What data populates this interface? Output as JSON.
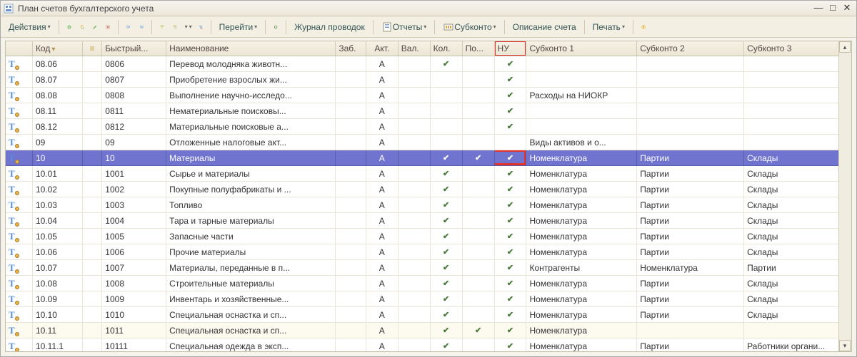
{
  "title": "План счетов бухгалтерского учета",
  "toolbar": {
    "actions": "Действия",
    "go": "Перейти",
    "journal": "Журнал проводок",
    "reports": "Отчеты",
    "subconto": "Субконто",
    "desc": "Описание счета",
    "print": "Печать"
  },
  "columns": {
    "c0": "",
    "code": "Код",
    "sort": "",
    "fast": "Быстрый...",
    "name": "Наименование",
    "zab": "Заб.",
    "akt": "Акт.",
    "val": "Вал.",
    "kol": "Кол.",
    "po": "По...",
    "nu": "НУ",
    "sub1": "Субконто 1",
    "sub2": "Субконто 2",
    "sub3": "Субконто 3"
  },
  "rows": [
    {
      "code": "08.06",
      "fast": "0806",
      "name": "Перевод молодняка животн...",
      "akt": "А",
      "val": "",
      "kol": "✔",
      "po": "",
      "nu": "✔",
      "s1": "",
      "s2": "",
      "s3": ""
    },
    {
      "code": "08.07",
      "fast": "0807",
      "name": "Приобретение взрослых жи...",
      "akt": "А",
      "val": "",
      "kol": "",
      "po": "",
      "nu": "✔",
      "s1": "",
      "s2": "",
      "s3": ""
    },
    {
      "code": "08.08",
      "fast": "0808",
      "name": "Выполнение научно-исследо...",
      "akt": "А",
      "val": "",
      "kol": "",
      "po": "",
      "nu": "✔",
      "s1": "Расходы на НИОКР",
      "s2": "",
      "s3": ""
    },
    {
      "code": "08.11",
      "fast": "0811",
      "name": "Нематериальные поисковы...",
      "akt": "А",
      "val": "",
      "kol": "",
      "po": "",
      "nu": "✔",
      "s1": "",
      "s2": "",
      "s3": ""
    },
    {
      "code": "08.12",
      "fast": "0812",
      "name": "Материальные поисковые а...",
      "akt": "А",
      "val": "",
      "kol": "",
      "po": "",
      "nu": "✔",
      "s1": "",
      "s2": "",
      "s3": ""
    },
    {
      "code": "09",
      "fast": "09",
      "name": "Отложенные налоговые акт...",
      "akt": "А",
      "val": "",
      "kol": "",
      "po": "",
      "nu": "",
      "s1": "Виды активов и о...",
      "s2": "",
      "s3": ""
    },
    {
      "code": "10",
      "fast": "10",
      "name": "Материалы",
      "akt": "А",
      "val": "",
      "kol": "✔",
      "po": "✔",
      "nu": "✔",
      "s1": "Номенклатура",
      "s2": "Партии",
      "s3": "Склады",
      "selected": true,
      "redcell": true
    },
    {
      "code": "10.01",
      "fast": "1001",
      "name": "Сырье и материалы",
      "akt": "А",
      "val": "",
      "kol": "✔",
      "po": "",
      "nu": "✔",
      "s1": "Номенклатура",
      "s2": "Партии",
      "s3": "Склады"
    },
    {
      "code": "10.02",
      "fast": "1002",
      "name": "Покупные полуфабрикаты и ...",
      "akt": "А",
      "val": "",
      "kol": "✔",
      "po": "",
      "nu": "✔",
      "s1": "Номенклатура",
      "s2": "Партии",
      "s3": "Склады"
    },
    {
      "code": "10.03",
      "fast": "1003",
      "name": "Топливо",
      "akt": "А",
      "val": "",
      "kol": "✔",
      "po": "",
      "nu": "✔",
      "s1": "Номенклатура",
      "s2": "Партии",
      "s3": "Склады"
    },
    {
      "code": "10.04",
      "fast": "1004",
      "name": "Тара и тарные материалы",
      "akt": "А",
      "val": "",
      "kol": "✔",
      "po": "",
      "nu": "✔",
      "s1": "Номенклатура",
      "s2": "Партии",
      "s3": "Склады"
    },
    {
      "code": "10.05",
      "fast": "1005",
      "name": "Запасные части",
      "akt": "А",
      "val": "",
      "kol": "✔",
      "po": "",
      "nu": "✔",
      "s1": "Номенклатура",
      "s2": "Партии",
      "s3": "Склады"
    },
    {
      "code": "10.06",
      "fast": "1006",
      "name": "Прочие материалы",
      "akt": "А",
      "val": "",
      "kol": "✔",
      "po": "",
      "nu": "✔",
      "s1": "Номенклатура",
      "s2": "Партии",
      "s3": "Склады"
    },
    {
      "code": "10.07",
      "fast": "1007",
      "name": "Материалы, переданные в п...",
      "akt": "А",
      "val": "",
      "kol": "✔",
      "po": "",
      "nu": "✔",
      "s1": "Контрагенты",
      "s2": "Номенклатура",
      "s3": "Партии"
    },
    {
      "code": "10.08",
      "fast": "1008",
      "name": "Строительные материалы",
      "akt": "А",
      "val": "",
      "kol": "✔",
      "po": "",
      "nu": "✔",
      "s1": "Номенклатура",
      "s2": "Партии",
      "s3": "Склады"
    },
    {
      "code": "10.09",
      "fast": "1009",
      "name": "Инвентарь и хозяйственные...",
      "akt": "А",
      "val": "",
      "kol": "✔",
      "po": "",
      "nu": "✔",
      "s1": "Номенклатура",
      "s2": "Партии",
      "s3": "Склады"
    },
    {
      "code": "10.10",
      "fast": "1010",
      "name": "Специальная оснастка и сп...",
      "akt": "А",
      "val": "",
      "kol": "✔",
      "po": "",
      "nu": "✔",
      "s1": "Номенклатура",
      "s2": "Партии",
      "s3": "Склады"
    },
    {
      "code": "10.11",
      "fast": "1011",
      "name": "Специальная оснастка и сп...",
      "akt": "А",
      "val": "",
      "kol": "✔",
      "po": "✔",
      "nu": "✔",
      "s1": "Номенклатура",
      "s2": "",
      "s3": "",
      "alt": true
    },
    {
      "code": "10.11.1",
      "fast": "10111",
      "name": "Специальная одежда в эксп...",
      "akt": "А",
      "val": "",
      "kol": "✔",
      "po": "",
      "nu": "✔",
      "s1": "Номенклатура",
      "s2": "Партии",
      "s3": "Работники органи..."
    }
  ]
}
